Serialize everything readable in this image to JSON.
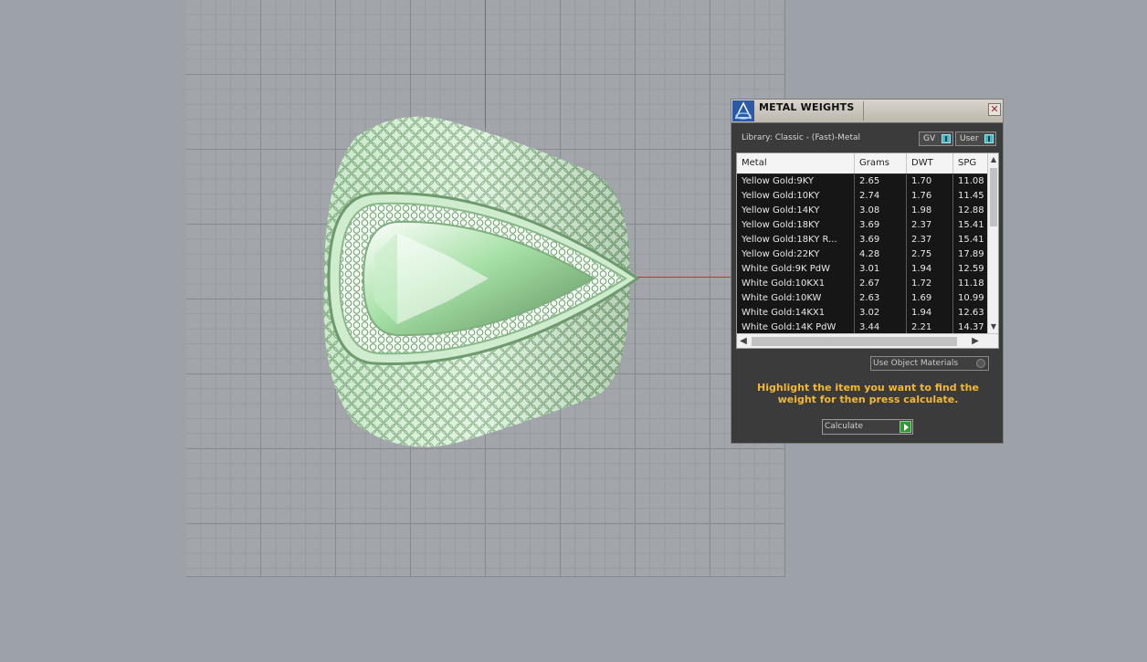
{
  "dialog": {
    "title": "METAL WEIGHTS",
    "close_glyph": "✕",
    "library_label": "Library: Classic - (Fast)-Metal",
    "toggles": [
      {
        "label": "GV",
        "icon": "toggle-switch-icon"
      },
      {
        "label": "User",
        "icon": "toggle-switch-icon"
      }
    ],
    "table": {
      "columns": [
        "Metal",
        "Grams",
        "DWT",
        "SPG"
      ],
      "rows": [
        [
          "Yellow Gold:9KY",
          "2.65",
          "1.70",
          "11.08"
        ],
        [
          "Yellow Gold:10KY",
          "2.74",
          "1.76",
          "11.45"
        ],
        [
          "Yellow Gold:14KY",
          "3.08",
          "1.98",
          "12.88"
        ],
        [
          "Yellow Gold:18KY",
          "3.69",
          "2.37",
          "15.41"
        ],
        [
          "Yellow Gold:18KY R...",
          "3.69",
          "2.37",
          "15.41"
        ],
        [
          "Yellow Gold:22KY",
          "4.28",
          "2.75",
          "17.89"
        ],
        [
          "White Gold:9K PdW",
          "3.01",
          "1.94",
          "12.59"
        ],
        [
          "White Gold:10KX1",
          "2.67",
          "1.72",
          "11.18"
        ],
        [
          "White Gold:10KW",
          "2.63",
          "1.69",
          "10.99"
        ],
        [
          "White Gold:14KX1",
          "3.02",
          "1.94",
          "12.63"
        ],
        [
          "White Gold:14K PdW",
          "3.44",
          "2.21",
          "14.37"
        ]
      ],
      "scroll_up": "▲",
      "scroll_down": "▼",
      "scroll_left": "◀",
      "scroll_right": "▶"
    },
    "use_object_materials": "Use Object Materials",
    "hint": "Highlight the item you want to find the weight for then press calculate.",
    "calculate_label": "Calculate"
  },
  "colors": {
    "viewport_bg": "#a2a6ab",
    "axis_y": "#2fa02f",
    "axis_x": "#b03a3a",
    "hint_text": "#f2b833",
    "ring": "#a6e0a6"
  }
}
